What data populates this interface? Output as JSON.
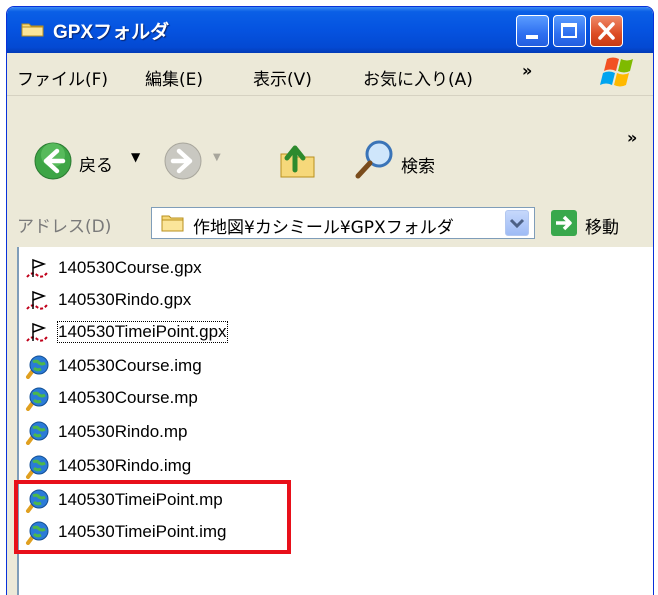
{
  "window": {
    "title": "GPXフォルダ"
  },
  "menu": {
    "items": [
      "ファイル(F)",
      "編集(E)",
      "表示(V)",
      "お気に入り(A)"
    ],
    "more": "»"
  },
  "toolbar": {
    "back_label": "戻る",
    "search_label": "検索",
    "more": "»"
  },
  "address": {
    "label": "アドレス(D)",
    "path": "作地図¥カシミール¥GPXフォルダ",
    "go_label": "移動"
  },
  "files": [
    {
      "name": "140530Course.gpx",
      "type": "gpx-file-icon"
    },
    {
      "name": "140530Rindo.gpx",
      "type": "gpx-file-icon"
    },
    {
      "name": "140530TimeiPoint.gpx",
      "type": "gpx-file-icon"
    },
    {
      "name": "140530Course.img",
      "type": "map-file-icon"
    },
    {
      "name": "140530Course.mp",
      "type": "map-file-icon"
    },
    {
      "name": "140530Rindo.mp",
      "type": "map-file-icon"
    },
    {
      "name": "140530Rindo.img",
      "type": "map-file-icon"
    },
    {
      "name": "140530TimeiPoint.mp",
      "type": "map-file-icon"
    },
    {
      "name": "140530TimeiPoint.img",
      "type": "map-file-icon"
    }
  ],
  "colors": {
    "titlebar": "#0553e0",
    "highlight": "#e8101a"
  }
}
